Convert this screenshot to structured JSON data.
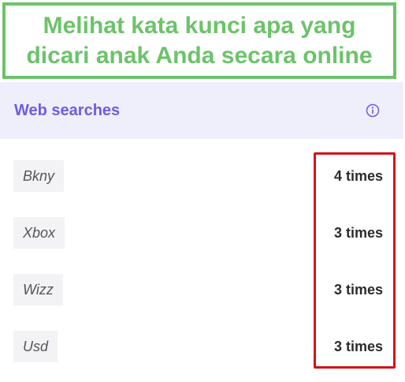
{
  "banner": {
    "line1": "Melihat kata kunci apa yang",
    "line2": "dicari anak Anda secara online"
  },
  "panel": {
    "title": "Web searches",
    "info_icon": "info-icon"
  },
  "searches": [
    {
      "term": "Bkny",
      "count": "4 times"
    },
    {
      "term": "Xbox",
      "count": "3 times"
    },
    {
      "term": "Wizz",
      "count": "3 times"
    },
    {
      "term": "Usd",
      "count": "3 times"
    }
  ],
  "colors": {
    "banner_green": "#6cc36a",
    "title_purple": "#6d5de0",
    "header_bg": "#efeefb",
    "highlight_red": "#d2141b"
  }
}
